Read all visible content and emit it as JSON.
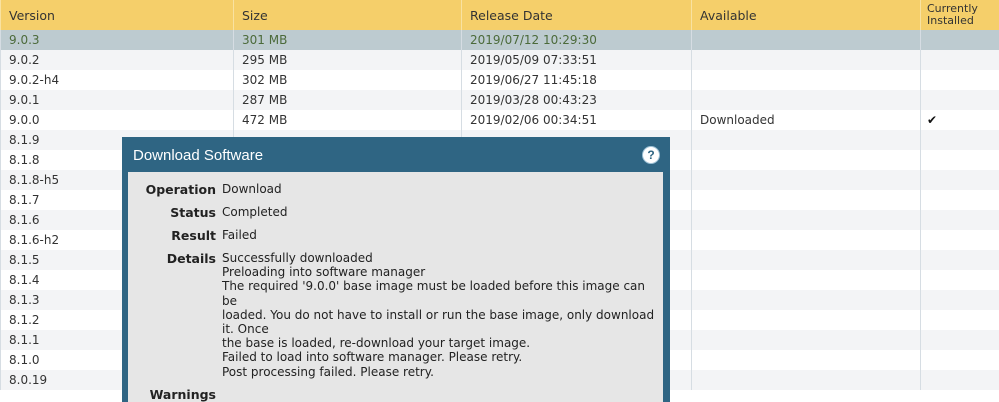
{
  "table": {
    "columns": [
      "Version",
      "Size",
      "Release Date",
      "Available",
      "Currently Installed"
    ],
    "rows": [
      {
        "version": "9.0.3",
        "size": "301 MB",
        "date": "2019/07/12 10:29:30",
        "available": "",
        "installed": ""
      },
      {
        "version": "9.0.2",
        "size": "295 MB",
        "date": "2019/05/09 07:33:51",
        "available": "",
        "installed": ""
      },
      {
        "version": "9.0.2-h4",
        "size": "302 MB",
        "date": "2019/06/27 11:45:18",
        "available": "",
        "installed": ""
      },
      {
        "version": "9.0.1",
        "size": "287 MB",
        "date": "2019/03/28 00:43:23",
        "available": "",
        "installed": ""
      },
      {
        "version": "9.0.0",
        "size": "472 MB",
        "date": "2019/02/06 00:34:51",
        "available": "Downloaded",
        "installed": "✔"
      },
      {
        "version": "8.1.9"
      },
      {
        "version": "8.1.8"
      },
      {
        "version": "8.1.8-h5"
      },
      {
        "version": "8.1.7"
      },
      {
        "version": "8.1.6"
      },
      {
        "version": "8.1.6-h2"
      },
      {
        "version": "8.1.5"
      },
      {
        "version": "8.1.4"
      },
      {
        "version": "8.1.3"
      },
      {
        "version": "8.1.2"
      },
      {
        "version": "8.1.1"
      },
      {
        "version": "8.1.0"
      },
      {
        "version": "8.0.19"
      }
    ]
  },
  "dialog": {
    "title": "Download Software",
    "operation_label": "Operation",
    "operation": "Download",
    "status_label": "Status",
    "status": "Completed",
    "result_label": "Result",
    "result": "Failed",
    "details_label": "Details",
    "details": [
      "Successfully downloaded",
      "Preloading into software manager",
      "The required '9.0.0' base image must be loaded before this image can be",
      "loaded. You do not have to install or run the base image, only download it. Once",
      "the base is loaded, re-download your target image.",
      "Failed to load into software manager. Please retry.",
      "Post processing failed. Please retry."
    ],
    "warnings_label": "Warnings"
  }
}
